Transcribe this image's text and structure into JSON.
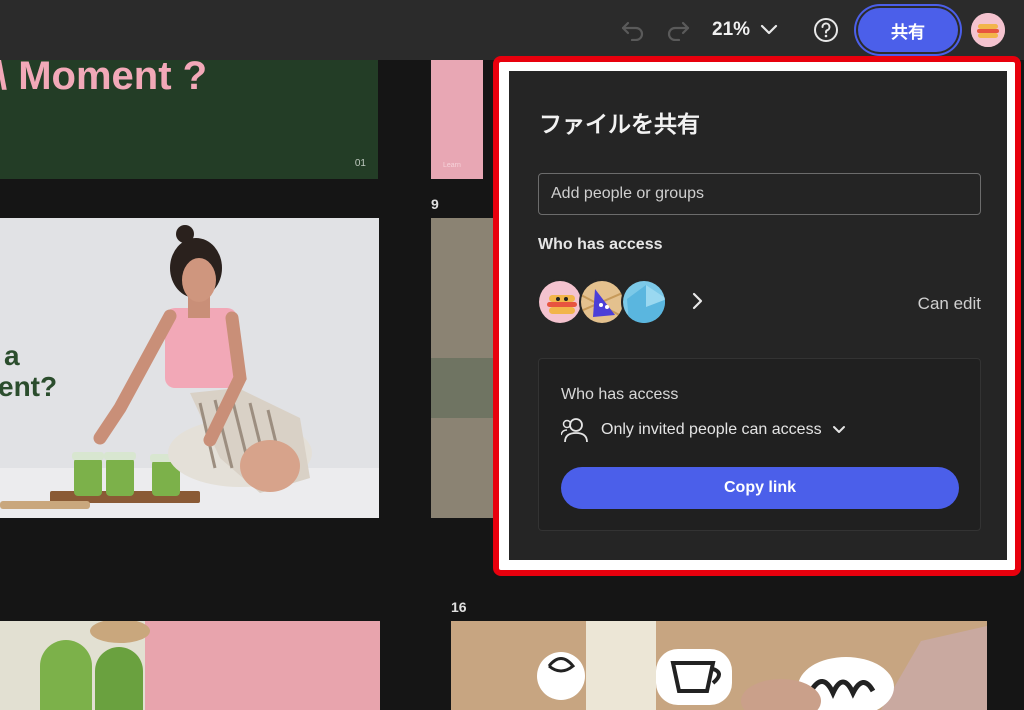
{
  "toolbar": {
    "zoom_label": "21%",
    "share_label": "共有"
  },
  "canvas": {
    "slide_top_left_text": "\\ Moment ?",
    "slide_top_left_number": "01",
    "slide_top_right_caption": "Learn",
    "slide_middle_text_line1": "a",
    "slide_middle_text_line2": "ent?",
    "slide_number_9": "9",
    "slide_number_16": "16"
  },
  "share_panel": {
    "title": "ファイルを共有",
    "add_placeholder": "Add people or groups",
    "who_has_access_heading": "Who has access",
    "permission_label": "Can edit",
    "link_section": {
      "heading": "Who has access",
      "access_option": "Only invited people can access",
      "copy_button": "Copy link"
    }
  },
  "colors": {
    "accent": "#4b5fea",
    "highlight_outline": "#e8000d",
    "panel_bg": "#252525",
    "topbar_bg": "#2b2b2b",
    "slide_green": "#233d26",
    "slide_pink_text": "#f2a9b8"
  },
  "icons": [
    "undo-icon",
    "redo-icon",
    "chevron-down-icon",
    "help-icon",
    "chevron-right-icon",
    "people-icon"
  ]
}
